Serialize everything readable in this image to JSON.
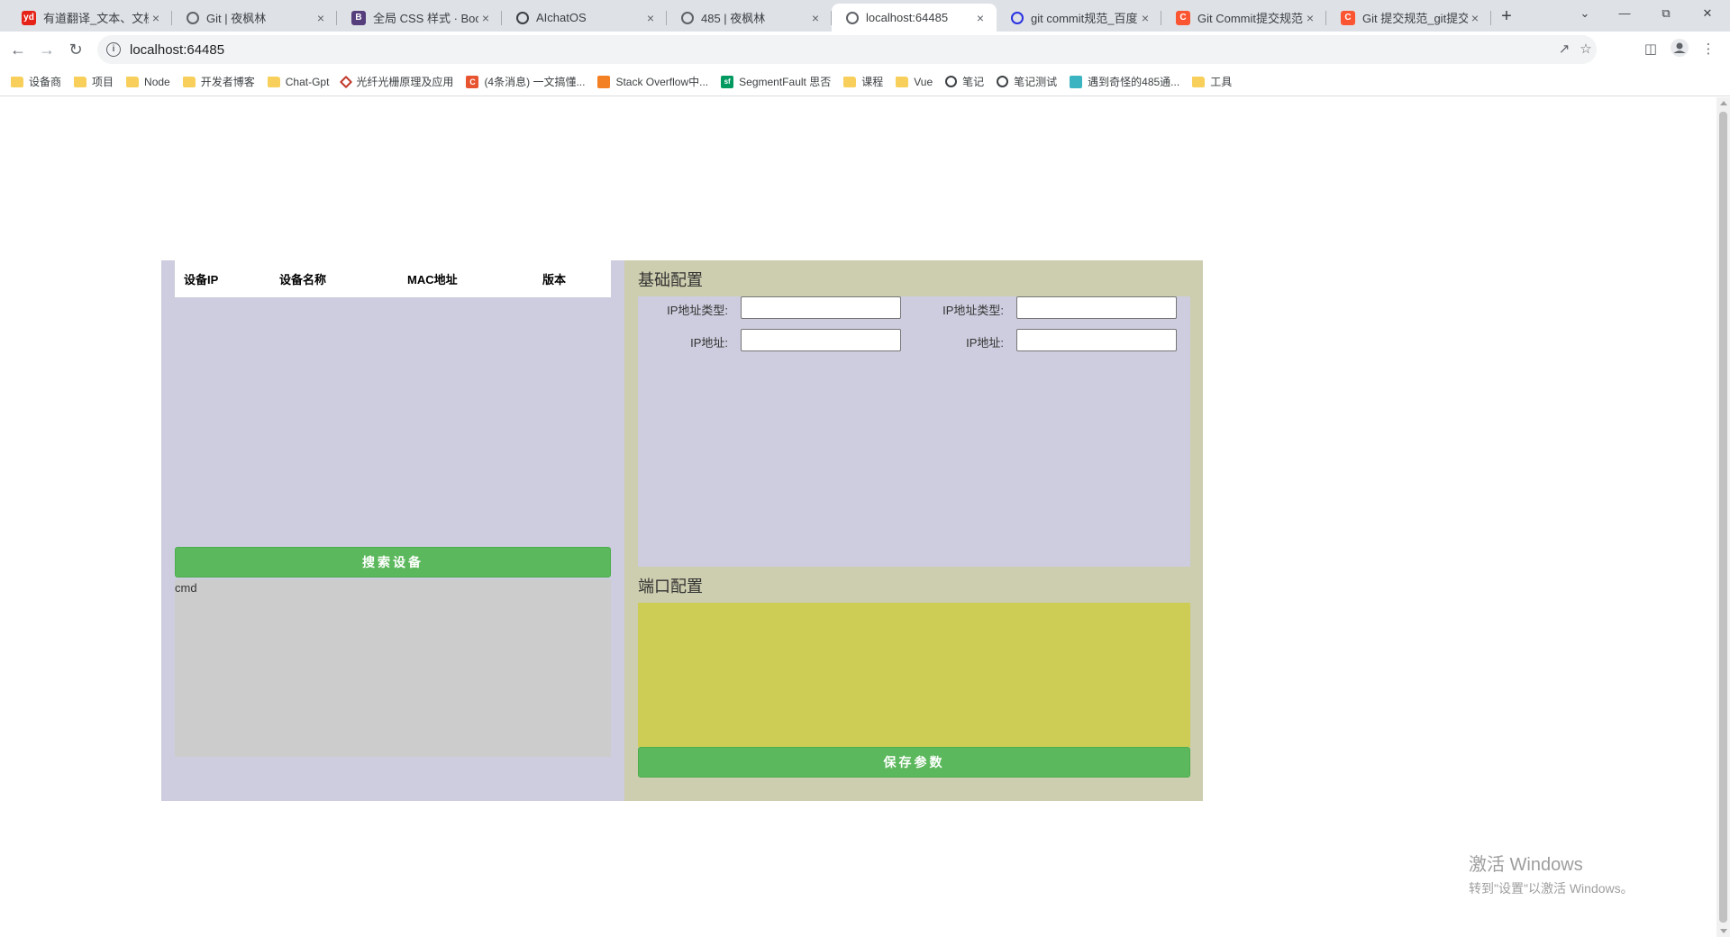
{
  "browser": {
    "tabs": [
      {
        "title": "有道翻译_文本、文档",
        "favicon": "youdao-icon",
        "color": "#e62117",
        "glyph": "yd"
      },
      {
        "title": "Git | 夜枫林",
        "favicon": "globe-icon",
        "color": "#5f6368",
        "glyph": ""
      },
      {
        "title": "全局 CSS 样式 · Boot",
        "favicon": "bootstrap-icon",
        "color": "#563d7c",
        "glyph": "B"
      },
      {
        "title": "AIchatOS",
        "favicon": "openai-icon",
        "color": "#3c4043",
        "glyph": ""
      },
      {
        "title": "485 | 夜枫林",
        "favicon": "globe-icon",
        "color": "#5f6368",
        "glyph": ""
      },
      {
        "title": "localhost:64485",
        "favicon": "globe-icon",
        "color": "#5f6368",
        "glyph": "",
        "active": true
      },
      {
        "title": "git commit规范_百度",
        "favicon": "baidu-icon",
        "color": "#2932e1",
        "glyph": ""
      },
      {
        "title": "Git Commit提交规范",
        "favicon": "csdn-icon",
        "color": "#fc5531",
        "glyph": "C"
      },
      {
        "title": "Git 提交规范_git提交",
        "favicon": "csdn-icon",
        "color": "#fc5531",
        "glyph": "C"
      }
    ],
    "new_tab": "+",
    "address": "localhost:64485",
    "bookmarks": [
      {
        "label": "设备商",
        "icon": "folder"
      },
      {
        "label": "项目",
        "icon": "folder"
      },
      {
        "label": "Node",
        "icon": "folder"
      },
      {
        "label": "开发者博客",
        "icon": "folder"
      },
      {
        "label": "Chat-Gpt",
        "icon": "folder"
      },
      {
        "label": "光纤光栅原理及应用",
        "icon": "diamond"
      },
      {
        "label": "(4条消息) 一文搞懂...",
        "icon": "red"
      },
      {
        "label": "Stack Overflow中...",
        "icon": "orange"
      },
      {
        "label": "SegmentFault 思否",
        "icon": "sf"
      },
      {
        "label": "课程",
        "icon": "folder"
      },
      {
        "label": "Vue",
        "icon": "folder"
      },
      {
        "label": "笔记",
        "icon": "globe"
      },
      {
        "label": "笔记测试",
        "icon": "globe"
      },
      {
        "label": "遇到奇怪的485通...",
        "icon": "teal"
      },
      {
        "label": "工具",
        "icon": "folder"
      }
    ]
  },
  "app": {
    "device_table": {
      "columns": [
        "设备IP",
        "设备名称",
        "MAC地址",
        "版本"
      ]
    },
    "search_button": "搜索设备",
    "cmd_label": "cmd",
    "basic_config": {
      "title": "基础配置",
      "fields": [
        {
          "label": "IP地址类型:",
          "value": ""
        },
        {
          "label": "IP地址类型:",
          "value": ""
        },
        {
          "label": "IP地址:",
          "value": ""
        },
        {
          "label": "IP地址:",
          "value": ""
        }
      ]
    },
    "port_config": {
      "title": "端口配置"
    },
    "save_button": "保存参数"
  },
  "watermark": {
    "title": "激活 Windows",
    "subtitle": "转到\"设置\"以激活 Windows。"
  },
  "colors": {
    "left_panel": "#cdcddf",
    "right_panel": "#cdcdaf",
    "port_box": "#cdcd55",
    "cmd_area": "#cccccc",
    "button": "#5cb85c"
  }
}
